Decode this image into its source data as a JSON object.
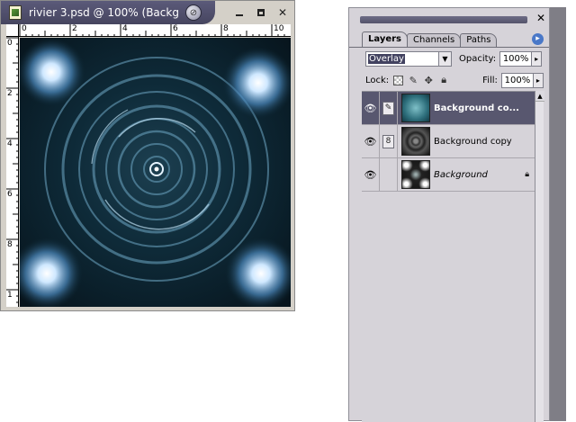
{
  "document": {
    "title": "rivier 3.psd @ 100% (Backg...",
    "ruler_top_ticks": [
      "0",
      "2",
      "4",
      "6",
      "8",
      "10"
    ],
    "ruler_left_ticks": [
      "0",
      "2",
      "4",
      "6",
      "8",
      "1"
    ]
  },
  "layers_panel": {
    "tabs": [
      "Layers",
      "Channels",
      "Paths"
    ],
    "blend_mode": "Overlay",
    "opacity_label": "Opacity:",
    "opacity_value": "100%",
    "lock_label": "Lock:",
    "fill_label": "Fill:",
    "fill_value": "100%",
    "layers": [
      {
        "name": "Background co...",
        "selected": true
      },
      {
        "name": "Background copy",
        "selected": false
      },
      {
        "name": "Background",
        "selected": false
      }
    ]
  },
  "icons": [
    "document-icon",
    "minimize-icon",
    "maximize-icon",
    "close-icon",
    "eye-icon",
    "brush-icon",
    "link-icon",
    "move-icon",
    "lock-icon"
  ],
  "colors": {
    "selected_layer": "#58576f",
    "title_bar": "#4f4e68",
    "panel_bg": "#d6d3d9"
  }
}
